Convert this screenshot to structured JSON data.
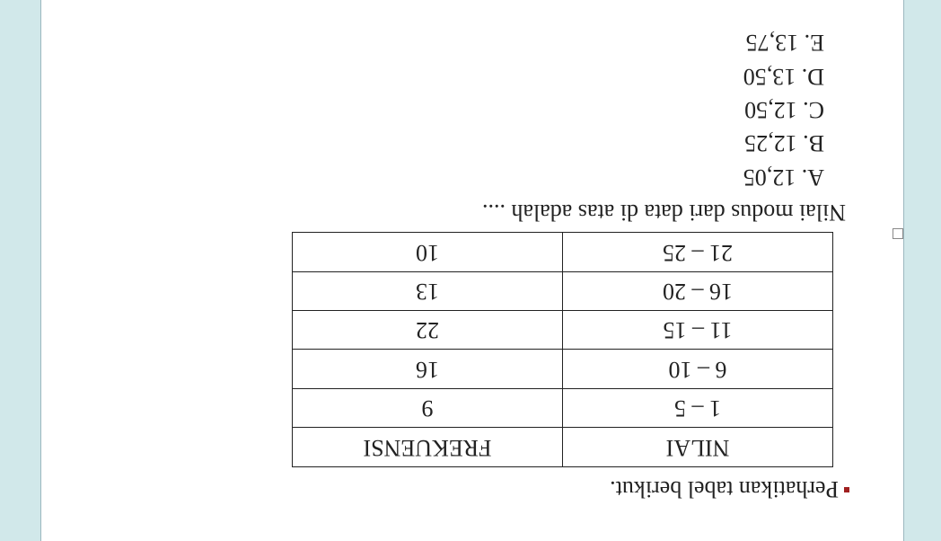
{
  "intro": "Perhatikan tabel berikut.",
  "chart_data": {
    "type": "table",
    "title": "",
    "columns": [
      "NILAI",
      "FREKUENSI"
    ],
    "rows": [
      {
        "nilai": "1 – 5",
        "frekuensi": "9"
      },
      {
        "nilai": "6 – 10",
        "frekuensi": "16"
      },
      {
        "nilai": "11 – 15",
        "frekuensi": "22"
      },
      {
        "nilai": "16 – 20",
        "frekuensi": "13"
      },
      {
        "nilai": "21 – 25",
        "frekuensi": "10"
      }
    ]
  },
  "question": "Nilai modus dari data di atas adalah ....",
  "options": {
    "a": "A. 12,05",
    "b": "B. 12,25",
    "c": "C. 12,50",
    "d": "D. 13,50",
    "e": "E. 13,75"
  }
}
